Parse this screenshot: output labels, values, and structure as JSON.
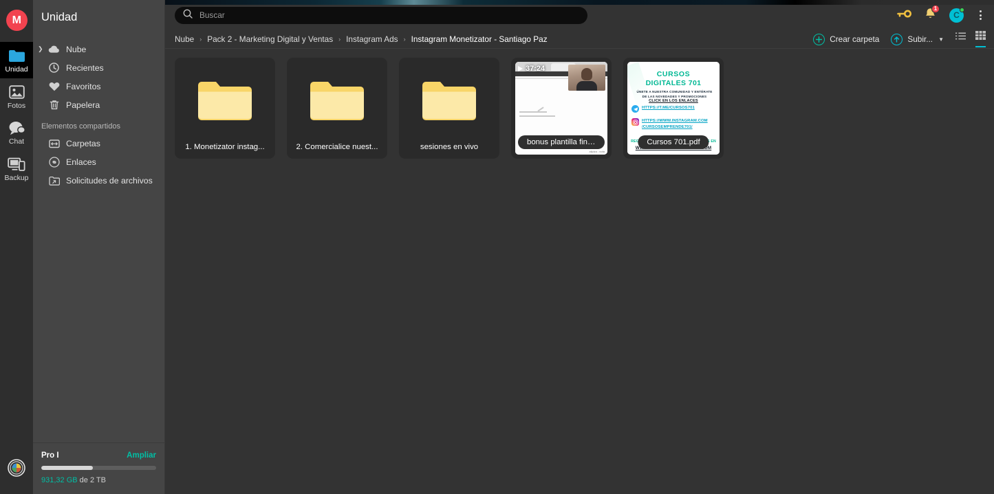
{
  "rail": {
    "logo_letter": "M",
    "items": [
      {
        "label": "Unidad",
        "icon": "folder-icon",
        "active": true
      },
      {
        "label": "Fotos",
        "icon": "photo-icon",
        "active": false
      },
      {
        "label": "Chat",
        "icon": "chat-icon",
        "active": false
      },
      {
        "label": "Backup",
        "icon": "backup-icon",
        "active": false
      }
    ],
    "bottom_icon": "accessibility-icon"
  },
  "sidebar": {
    "title": "Unidad",
    "items": [
      {
        "label": "Nube",
        "icon": "cloud-icon",
        "expandable": true
      },
      {
        "label": "Recientes",
        "icon": "clock-icon",
        "expandable": false
      },
      {
        "label": "Favoritos",
        "icon": "heart-icon",
        "expandable": false
      },
      {
        "label": "Papelera",
        "icon": "trash-icon",
        "expandable": false
      }
    ],
    "shared_section": "Elementos compartidos",
    "shared_items": [
      {
        "label": "Carpetas",
        "icon": "shared-folders-icon"
      },
      {
        "label": "Enlaces",
        "icon": "link-icon"
      },
      {
        "label": "Solicitudes de archivos",
        "icon": "file-request-icon"
      }
    ],
    "storage": {
      "plan": "Pro I",
      "upgrade_label": "Ampliar",
      "used": "931,32 GB",
      "of_label": "de 2 TB",
      "percent": 45
    }
  },
  "topbar": {
    "search_placeholder": "Buscar",
    "search_value": "",
    "key_icon": "key-icon",
    "bell_icon": "bell-icon",
    "bell_badge": "1",
    "avatar_letter": "C",
    "kebab_icon": "more-vertical-icon"
  },
  "breadcrumb": {
    "items": [
      "Nube",
      "Pack 2 - Marketing Digital y Ventas",
      "Instagram Ads",
      "Instagram Monetizator - Santiago Paz"
    ],
    "separator": "›"
  },
  "toolbar": {
    "create_folder_label": "Crear carpeta",
    "upload_label": "Subir...",
    "list_view_icon": "list-view-icon",
    "grid_view_icon": "grid-view-icon",
    "active_view": "grid"
  },
  "files": [
    {
      "type": "folder",
      "name": "1. Monetizator instag..."
    },
    {
      "type": "folder",
      "name": "2. Comercialice nuest..."
    },
    {
      "type": "folder",
      "name": "sesiones en vivo"
    },
    {
      "type": "video",
      "name": "bonus plantilla finanz...",
      "duration": "37:24"
    },
    {
      "type": "pdf",
      "name": "Cursos 701.pdf"
    }
  ],
  "pdf_preview": {
    "title_line1": "CURSOS",
    "title_line2": "DIGITALES 701",
    "subtitle_line1": "ÚNETE A NUESTRA COMUNIDAD Y ENTÉRATE",
    "subtitle_line2": "DE LAS NOVEDADES Y PROMOCIONES",
    "click_label": "CLICK EN LOS ENLACES",
    "telegram_url": "HTTPS://T.ME/CURSOS701",
    "instagram_url_line1": "HTTPS://WWW.INSTAGRAM.COM",
    "instagram_url_line2": "/CURSOSEMPRENDE701/",
    "footer_line1": "REGISTRATE Y MIRA TODOS LOS CURSOS EN",
    "footer_line2": "WWW.CURSOSDIGITALES701.COM"
  },
  "colors": {
    "accent_cyan": "#00c0d4",
    "accent_green": "#00bfa5",
    "brand_red": "#f2434f",
    "folder_yellow": "#fbe38e",
    "rail_bg": "#2e2e2e",
    "sidebar_bg": "#454545",
    "main_bg": "#333333",
    "card_bg": "#2a2a2a"
  }
}
